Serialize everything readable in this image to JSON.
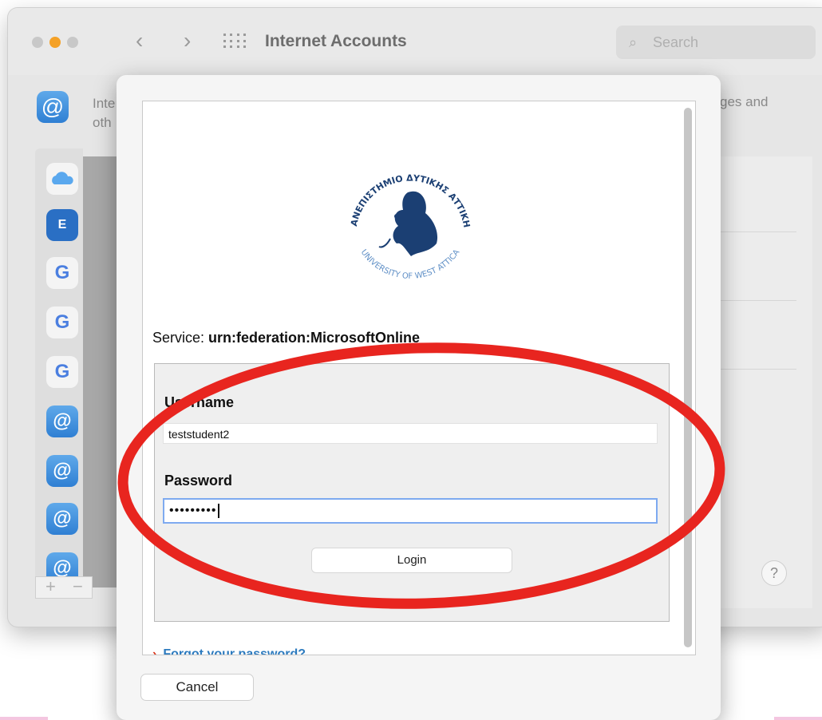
{
  "window": {
    "title": "Internet Accounts",
    "search_placeholder": "Search",
    "description_left_1": "Inte",
    "description_left_2": "oth",
    "description_right": "ges and"
  },
  "sidebar": {
    "accounts": [
      "cloud",
      "exchange",
      "G",
      "G",
      "G",
      "@",
      "@",
      "@",
      "@"
    ]
  },
  "toolbar": {
    "add": "+",
    "remove": "−"
  },
  "help_label": "?",
  "sheet": {
    "logo_text_top": "ΠΑΝΕΠΙΣΤΗΜΙΟ ΔΥΤΙΚΗΣ ΑΤΤΙΚΗΣ",
    "logo_text_bottom": "UNIVERSITY OF WEST ATTICA",
    "service_label": "Service:",
    "service_value": "urn:federation:MicrosoftOnline",
    "username_label": "Username",
    "username_value": "teststudent2",
    "password_label": "Password",
    "password_value": "•••••••••",
    "login_label": "Login",
    "forgot_label": "Forgot your password?",
    "cancel_label": "Cancel"
  },
  "colors": {
    "annotation": "#e8251f",
    "accent_blue": "#2f7fd3",
    "logo_navy": "#1b3f73"
  }
}
